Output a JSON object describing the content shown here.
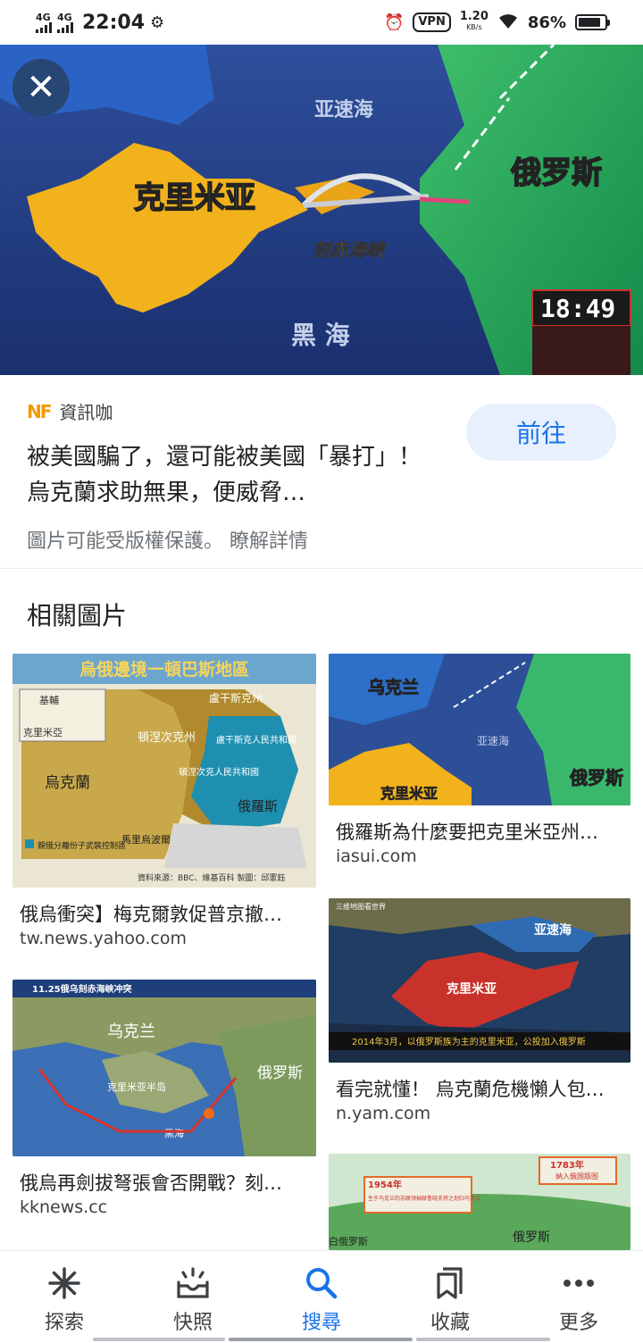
{
  "status": {
    "net1": "4G",
    "net2": "4G",
    "time": "22:04",
    "vpn": "VPN",
    "speed_value": "1.20",
    "speed_unit": "KB/s",
    "battery": "86%",
    "battery_level": 0.86
  },
  "hero": {
    "labels": {
      "crimea": "克里米亚",
      "azov": "亚速海",
      "russia": "俄罗斯",
      "strait": "刻赤海峡",
      "black_sea": "黑 海",
      "clock": "18:49"
    }
  },
  "result": {
    "source_logo": "NF",
    "source_name": "資訊咖",
    "title": "被美國騙了，還可能被美國「暴打」！ 烏克蘭求助無果，便威脅…",
    "copyright": "圖片可能受版權保護。 瞭解詳情",
    "go_button": "前往"
  },
  "related": {
    "heading": "相關圖片",
    "items": [
      {
        "caption": "俄烏衝突】梅克爾敦促普京撤…",
        "source": "tw.news.yahoo.com",
        "img": {
          "title": "烏俄邊境一頓巴斯地區",
          "l1": "基輔",
          "l2": "克里米亞",
          "l3": "烏克蘭",
          "l4": "頓涅次克州",
          "l5": "盧干斯克州",
          "l6": "盧干斯克人民共和國",
          "l7": "頓涅次克人民共和國",
          "l8": "俄羅斯",
          "l9": "馬里烏波爾",
          "l10": "親俄分離份子武裝控制區",
          "l11": "資料來源：BBC、維基百科  製圖：邱憲鈺"
        }
      },
      {
        "caption": "俄羅斯為什麼要把克里米亞州…",
        "source": "iasui.com",
        "img": {
          "l1": "乌克兰",
          "l2": "亚速海",
          "l3": "克里米亚",
          "l4": "俄罗斯"
        }
      },
      {
        "caption": "看完就懂！ 烏克蘭危機懶人包…",
        "source": "n.yam.com",
        "img": {
          "l1": "三维地图看世界",
          "l2": "亚速海",
          "l3": "克里米亚",
          "l4": "2014年3月，以俄罗斯族为主的克里米亚，公投加入俄罗斯"
        }
      },
      {
        "caption": "俄烏再劍拔弩張會否開戰？刻…",
        "source": "kknews.cc",
        "img": {
          "l1": "11.25俄乌刻赤海峡冲突",
          "l2": "乌克兰",
          "l3": "俄罗斯",
          "l4": "克里米亚半岛",
          "l5": "黑海"
        }
      },
      {
        "caption": "",
        "source": "",
        "img": {
          "l1": "1954年",
          "l2": "生于乌克兰的苏联领袖赫鲁晓夫将之划归乌克兰",
          "l3": "1783年",
          "l4": "纳入俄国版图",
          "l5": "白俄罗斯",
          "l6": "俄罗斯"
        }
      }
    ]
  },
  "nav": {
    "items": [
      {
        "label": "探索",
        "icon": "asterisk-icon"
      },
      {
        "label": "快照",
        "icon": "snapshot-inbox-icon"
      },
      {
        "label": "搜尋",
        "icon": "search-icon"
      },
      {
        "label": "收藏",
        "icon": "collections-icon"
      },
      {
        "label": "更多",
        "icon": "more-dots-icon"
      }
    ],
    "active": "搜尋"
  }
}
